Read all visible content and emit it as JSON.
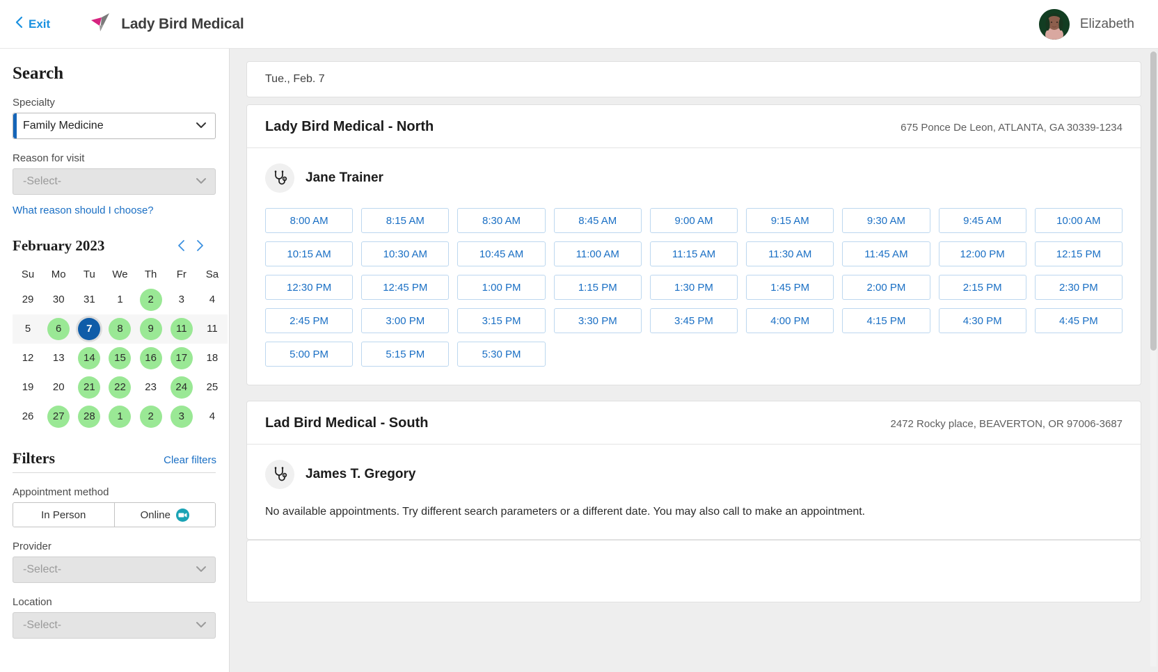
{
  "header": {
    "exit_label": "Exit",
    "exit_icon": "chevron-left-icon",
    "logo_icon": "lady-bird-logo-icon",
    "brand": "Lady Bird Medical",
    "user_name": "Elizabeth",
    "avatar_icon": "user-avatar"
  },
  "sidebar": {
    "search_title": "Search",
    "specialty_label": "Specialty",
    "specialty_value": "Family Medicine",
    "reason_label": "Reason for visit",
    "reason_value": "-Select-",
    "reason_placeholder": "-Select-",
    "reason_help_link": "What reason should I choose?",
    "calendar": {
      "title": "February 2023",
      "prev_icon": "chevron-left-icon",
      "next_icon": "chevron-right-icon",
      "weekdays": [
        "Su",
        "Mo",
        "Tu",
        "We",
        "Th",
        "Fr",
        "Sa"
      ],
      "weeks": [
        [
          {
            "d": "29",
            "state": "plain"
          },
          {
            "d": "30",
            "state": "plain"
          },
          {
            "d": "31",
            "state": "plain"
          },
          {
            "d": "1",
            "state": "plain"
          },
          {
            "d": "2",
            "state": "avail"
          },
          {
            "d": "3",
            "state": "plain"
          },
          {
            "d": "4",
            "state": "plain"
          }
        ],
        [
          {
            "d": "5",
            "state": "plain"
          },
          {
            "d": "6",
            "state": "avail"
          },
          {
            "d": "7",
            "state": "selected"
          },
          {
            "d": "8",
            "state": "avail"
          },
          {
            "d": "9",
            "state": "avail"
          },
          {
            "d": "11",
            "state": "avail"
          },
          {
            "d": "11",
            "state": "plain"
          }
        ],
        [
          {
            "d": "12",
            "state": "plain"
          },
          {
            "d": "13",
            "state": "plain"
          },
          {
            "d": "14",
            "state": "avail"
          },
          {
            "d": "15",
            "state": "avail"
          },
          {
            "d": "16",
            "state": "avail"
          },
          {
            "d": "17",
            "state": "avail"
          },
          {
            "d": "18",
            "state": "plain"
          }
        ],
        [
          {
            "d": "19",
            "state": "plain"
          },
          {
            "d": "20",
            "state": "plain"
          },
          {
            "d": "21",
            "state": "avail"
          },
          {
            "d": "22",
            "state": "avail"
          },
          {
            "d": "23",
            "state": "plain"
          },
          {
            "d": "24",
            "state": "avail"
          },
          {
            "d": "25",
            "state": "plain"
          }
        ],
        [
          {
            "d": "26",
            "state": "plain"
          },
          {
            "d": "27",
            "state": "avail"
          },
          {
            "d": "28",
            "state": "avail"
          },
          {
            "d": "1",
            "state": "avail"
          },
          {
            "d": "2",
            "state": "avail"
          },
          {
            "d": "3",
            "state": "avail"
          },
          {
            "d": "4",
            "state": "plain"
          }
        ]
      ],
      "current_week_index": 1
    },
    "filters_title": "Filters",
    "clear_filters": "Clear filters",
    "appt_method_label": "Appointment method",
    "appt_method_options": [
      "In Person",
      "Online"
    ],
    "online_icon": "video-camera-icon",
    "provider_label": "Provider",
    "provider_value": "-Select-",
    "location_label": "Location",
    "location_value": "-Select-"
  },
  "main": {
    "date_bar": "Tue., Feb. 7",
    "locations": [
      {
        "name": "Lady Bird Medical - North",
        "address": "675 Ponce De Leon, ATLANTA, GA 30339-1234",
        "provider": {
          "name": "Jane Trainer",
          "icon": "stethoscope-icon"
        },
        "slots": [
          "8:00 AM",
          "8:15 AM",
          "8:30 AM",
          "8:45 AM",
          "9:00 AM",
          "9:15 AM",
          "9:30 AM",
          "9:45 AM",
          "10:00 AM",
          "10:15 AM",
          "10:30 AM",
          "10:45 AM",
          "11:00 AM",
          "11:15 AM",
          "11:30 AM",
          "11:45 AM",
          "12:00 PM",
          "12:15 PM",
          "12:30 PM",
          "12:45 PM",
          "1:00 PM",
          "1:15 PM",
          "1:30 PM",
          "1:45 PM",
          "2:00 PM",
          "2:15 PM",
          "2:30 PM",
          "2:45 PM",
          "3:00 PM",
          "3:15 PM",
          "3:30 PM",
          "3:45 PM",
          "4:00 PM",
          "4:15 PM",
          "4:30 PM",
          "4:45 PM",
          "5:00 PM",
          "5:15 PM",
          "5:30 PM"
        ],
        "empty_message": ""
      },
      {
        "name": "Lad Bird Medical - South",
        "address": "2472 Rocky place, BEAVERTON, OR 97006-3687",
        "provider": {
          "name": "James T. Gregory",
          "icon": "stethoscope-icon"
        },
        "slots": [],
        "empty_message": "No available appointments. Try different search parameters or a different date. You may also call to make an appointment."
      }
    ]
  },
  "colors": {
    "link_blue": "#1a6fc4",
    "accent_blue": "#1565b8",
    "selected_day": "#0f5ca8",
    "available_day": "#9ae895",
    "brand_magenta": "#d6237f",
    "video_teal": "#1aa3b5"
  }
}
